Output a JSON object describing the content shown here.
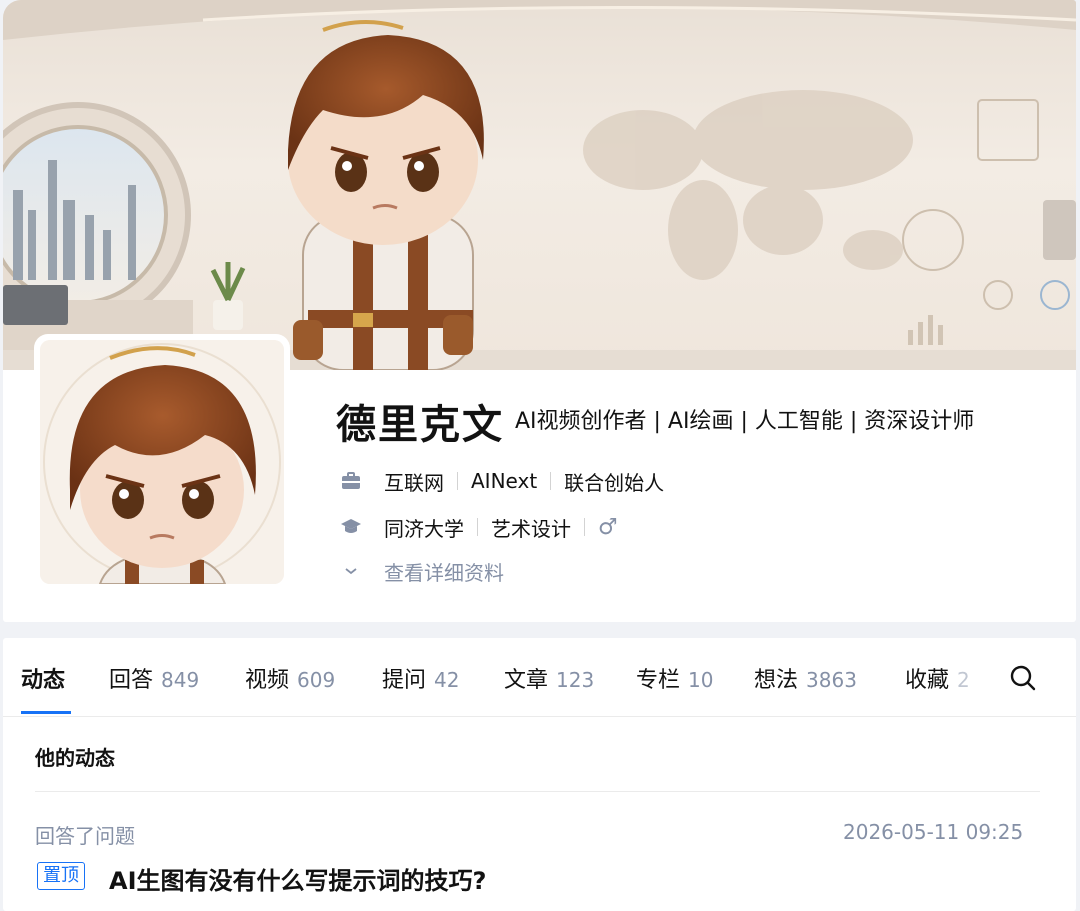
{
  "profile": {
    "name": "德里克文",
    "headline": "AI视频创作者 | AI绘画 | 人工智能 | 资深设计师",
    "work": [
      "互联网",
      "AINext",
      "联合创始人"
    ],
    "education": [
      "同济大学",
      "艺术设计"
    ],
    "gender_icon": "♂",
    "more_label": "查看详细资料"
  },
  "tabs": [
    {
      "label": "动态",
      "count": ""
    },
    {
      "label": "回答",
      "count": "849"
    },
    {
      "label": "视频",
      "count": "609"
    },
    {
      "label": "提问",
      "count": "42"
    },
    {
      "label": "文章",
      "count": "123"
    },
    {
      "label": "专栏",
      "count": "10"
    },
    {
      "label": "想法",
      "count": "3863"
    },
    {
      "label": "收藏",
      "count": "2"
    }
  ],
  "activity": {
    "section_title": "他的动态",
    "item": {
      "action": "回答了问题",
      "time": "2026-05-11 09:25",
      "pin_label": "置顶",
      "question": "AI生图有没有什么写提示词的技巧?"
    }
  },
  "colors": {
    "accent": "#1772f6",
    "muted": "#8590a6"
  }
}
